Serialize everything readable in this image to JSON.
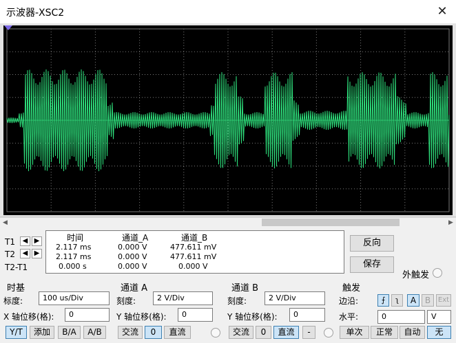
{
  "window": {
    "title": "示波器-XSC2",
    "close_glyph": "✕"
  },
  "readout": {
    "headers": [
      "时间",
      "通道_A",
      "通道_B"
    ],
    "rows": [
      {
        "label": "T1",
        "time": "2.117 ms",
        "ch_a": "0.000 V",
        "ch_b": "477.611 mV"
      },
      {
        "label": "T2",
        "time": "2.117 ms",
        "ch_a": "0.000 V",
        "ch_b": "477.611 mV"
      },
      {
        "label": "T2-T1",
        "time": "0.000 s",
        "ch_a": "0.000 V",
        "ch_b": "0.000 V"
      }
    ]
  },
  "side_buttons": {
    "reverse": "反向",
    "save": "保存",
    "ext_trigger": "外触发"
  },
  "timebase": {
    "title": "时基",
    "scale_label": "标度:",
    "scale_value": "100 us/Div",
    "xpos_label": "X 轴位移(格):",
    "xpos_value": "0",
    "modes": [
      "Y/T",
      "添加",
      "B/A",
      "A/B"
    ]
  },
  "channel_a": {
    "title": "通道 A",
    "scale_label": "刻度:",
    "scale_value": "2  V/Div",
    "ypos_label": "Y 轴位移(格):",
    "ypos_value": "0",
    "coupling": [
      "交流",
      "0",
      "直流"
    ]
  },
  "channel_b": {
    "title": "通道 B",
    "scale_label": "刻度:",
    "scale_value": "2  V/Div",
    "ypos_label": "Y 轴位移(格):",
    "ypos_value": "0",
    "coupling": [
      "交流",
      "0",
      "直流",
      "-"
    ]
  },
  "trigger": {
    "title": "触发",
    "edge_label": "边沿:",
    "edge_buttons": [
      "A",
      "B",
      "Ext"
    ],
    "level_label": "水平:",
    "level_value": "0",
    "level_unit": "V",
    "modes": [
      "单次",
      "正常",
      "自动",
      "无"
    ]
  },
  "colors": {
    "trace": "#2ee07c",
    "grid": "#7a7a7a",
    "screen_bg": "#000000",
    "selected_button": "#cce4f7",
    "selected_border": "#3c7fb1"
  }
}
